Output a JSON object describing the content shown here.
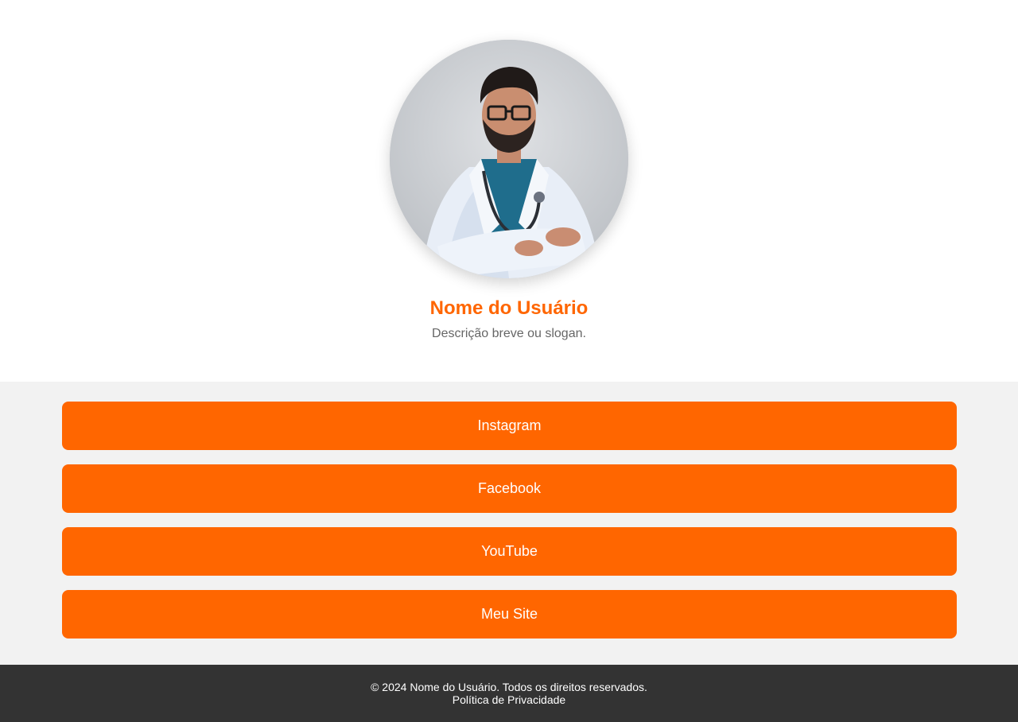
{
  "profile": {
    "name": "Nome do Usuário",
    "description": "Descrição breve ou slogan.",
    "avatar_icon": "user-photo"
  },
  "links": [
    {
      "label": "Instagram"
    },
    {
      "label": "Facebook"
    },
    {
      "label": "YouTube"
    },
    {
      "label": "Meu Site"
    }
  ],
  "footer": {
    "copyright": "© 2024 Nome do Usuário. Todos os direitos reservados.",
    "privacy_link": "Política de Privacidade"
  },
  "colors": {
    "accent": "#ff6600",
    "links_background": "#f2f2f2",
    "footer_background": "#333333",
    "description_text": "#666666"
  }
}
